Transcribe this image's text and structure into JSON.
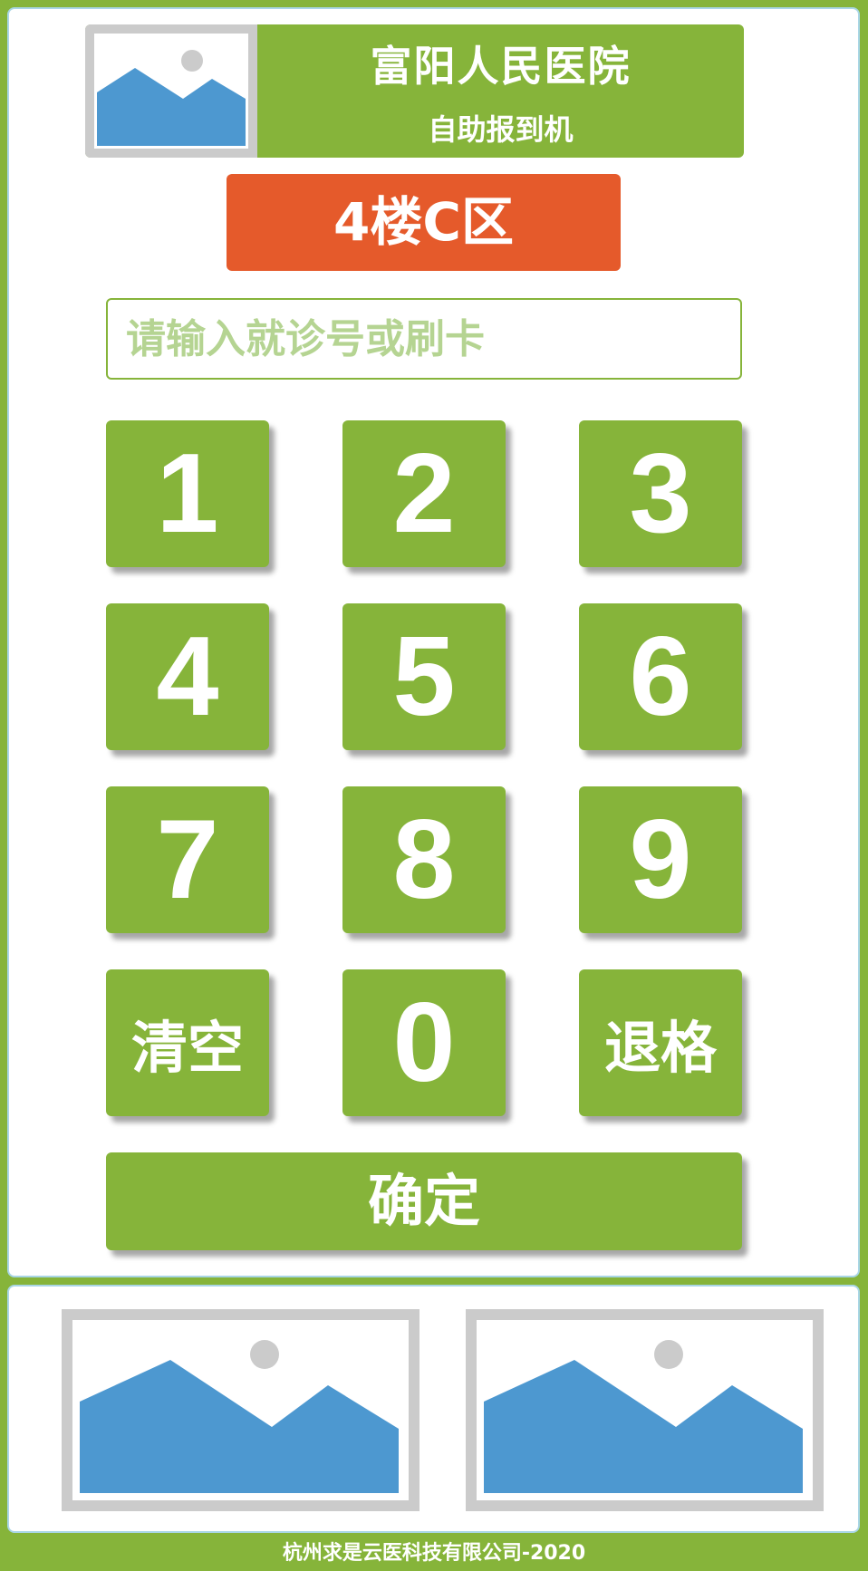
{
  "header": {
    "hospital_name": "富阳人民医院",
    "device_name": "自助报到机",
    "logo_icon": "image-placeholder-icon"
  },
  "location": {
    "label": "4楼C区"
  },
  "input": {
    "placeholder": "请输入就诊号或刷卡",
    "value": ""
  },
  "keypad": {
    "keys": [
      "1",
      "2",
      "3",
      "4",
      "5",
      "6",
      "7",
      "8",
      "9",
      "清空",
      "0",
      "退格"
    ],
    "confirm_label": "确定"
  },
  "ads": {
    "left_icon": "image-placeholder-icon",
    "right_icon": "image-placeholder-icon"
  },
  "footer": {
    "text": "杭州求是云医科技有限公司-2020"
  },
  "colors": {
    "brand_green": "#86b43a",
    "location_orange": "#e55a2b",
    "placeholder_green": "#b5d492",
    "image_blue": "#4d98d0",
    "image_frame_gray": "#cbcbcb"
  }
}
